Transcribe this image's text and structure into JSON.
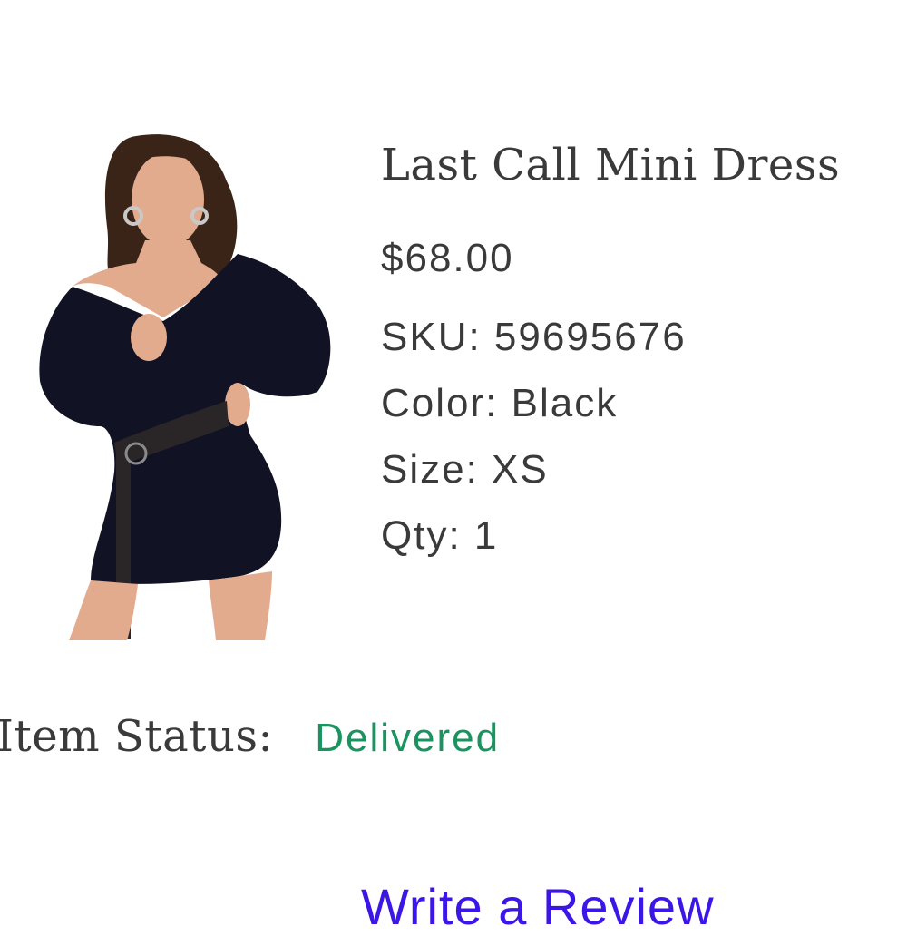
{
  "product": {
    "title": "Last Call Mini Dress",
    "price": "$68.00",
    "sku": "SKU: 59695676",
    "color": "Color: Black",
    "size": "Size: XS",
    "qty": "Qty: 1"
  },
  "status": {
    "label": "Item Status:",
    "value": "Delivered",
    "value_color": "#1a9360"
  },
  "review": {
    "label": "Write a Review",
    "color": "#3b16e6"
  }
}
